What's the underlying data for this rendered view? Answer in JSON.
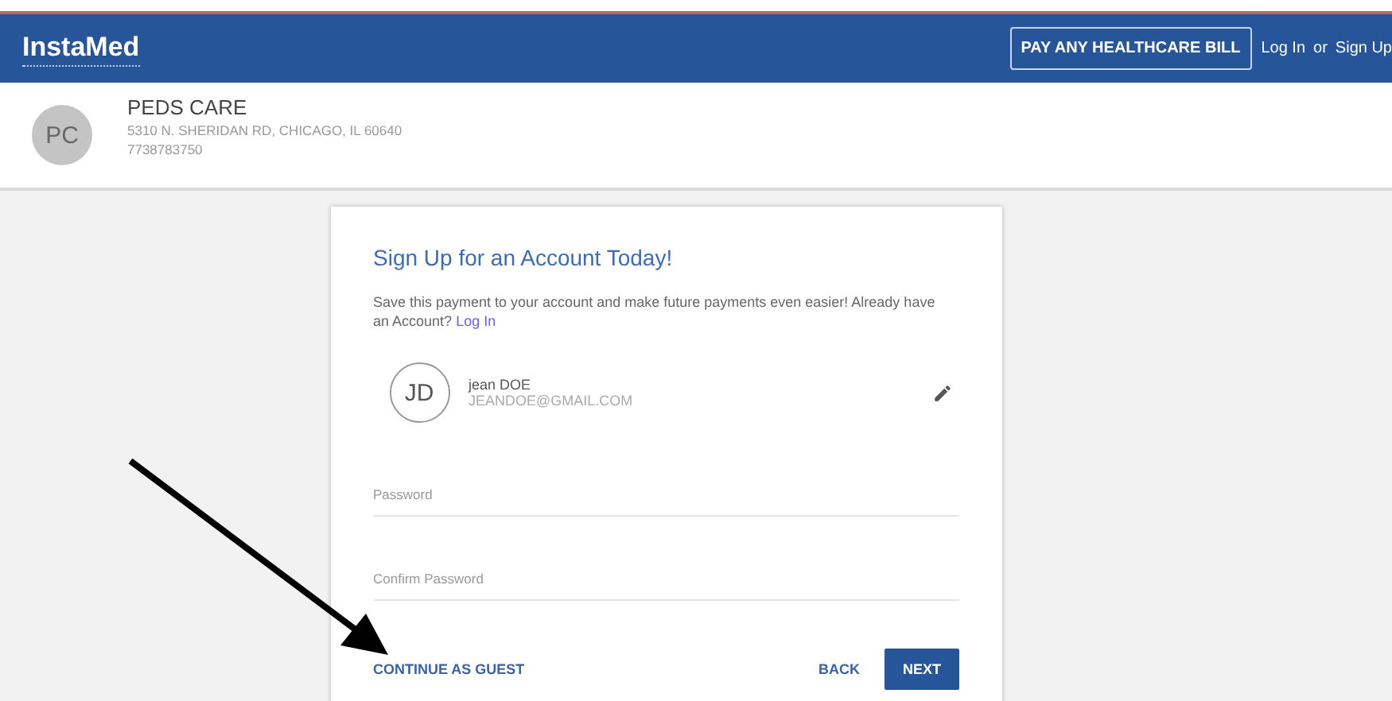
{
  "header": {
    "logo": "InstaMed",
    "pay_button": "PAY ANY HEALTHCARE BILL",
    "login_link": "Log In",
    "separator": "or",
    "signup_link": "Sign Up"
  },
  "provider": {
    "initials": "PC",
    "name": "PEDS CARE",
    "address": "5310 N. SHERIDAN RD, CHICAGO, IL 60640",
    "phone": "7738783750"
  },
  "card": {
    "title": "Sign Up for an Account Today!",
    "message": "Save this payment to your account and make future payments even easier! Already have an Account?",
    "login_link": "Log In",
    "user": {
      "initials": "JD",
      "name": "jean DOE",
      "email": "JEANDOE@GMAIL.COM"
    },
    "fields": [
      {
        "placeholder": "Password"
      },
      {
        "placeholder": "Confirm Password"
      }
    ],
    "guest_button": "CONTINUE AS GUEST",
    "back_button": "BACK",
    "next_button": "NEXT"
  }
}
